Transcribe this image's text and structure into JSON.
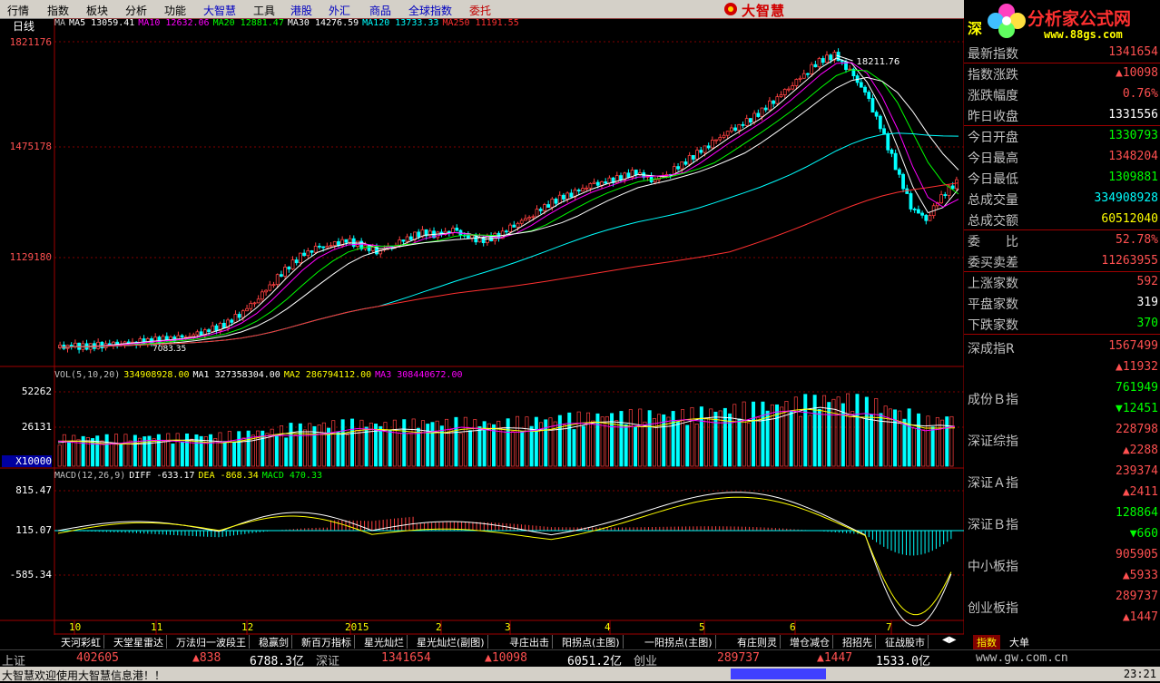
{
  "menu": [
    "行情",
    "指数",
    "板块",
    "分析",
    "功能",
    "大智慧",
    "工具",
    "港股",
    "外汇",
    "商品",
    "全球指数",
    "委托"
  ],
  "menu_colors": [
    "#000000",
    "#000000",
    "#000000",
    "#000000",
    "#000000",
    "#0000c0",
    "#000000",
    "#0000c0",
    "#0000c0",
    "#0000c0",
    "#0000c0",
    "#c00000"
  ],
  "brand": "大智慧",
  "right_logo": {
    "title": "分析家公式网",
    "url": "www.88gs.com",
    "corner_char": "深"
  },
  "chart_label": "日线",
  "ma_legend": [
    {
      "text": "MA",
      "color": "#c0c0c0"
    },
    {
      "text": "MA5 13059.41",
      "color": "#ffffff"
    },
    {
      "text": "MA10 12632.06",
      "color": "#ff00ff"
    },
    {
      "text": "MA20 12881.47",
      "color": "#00ff00"
    },
    {
      "text": "MA30 14276.59",
      "color": "#ffffff"
    },
    {
      "text": "MA120 13733.33",
      "color": "#00ffff"
    },
    {
      "text": "MA250 11191.55",
      "color": "#ff3030"
    }
  ],
  "vol_legend": [
    {
      "text": "VOL(5,10,20)",
      "color": "#c0c0c0"
    },
    {
      "text": "334908928.00",
      "color": "#ffff00"
    },
    {
      "text": "MA1 327358304.00",
      "color": "#ffffff"
    },
    {
      "text": "MA2 286794112.00",
      "color": "#ffff00"
    },
    {
      "text": "MA3 308440672.00",
      "color": "#ff00ff"
    }
  ],
  "macd_legend": [
    {
      "text": "MACD(12,26,9)",
      "color": "#c0c0c0"
    },
    {
      "text": "DIFF -633.17",
      "color": "#ffffff"
    },
    {
      "text": "DEA -868.34",
      "color": "#ffff00"
    },
    {
      "text": "MACD 470.33",
      "color": "#00ff00"
    }
  ],
  "price_axis": [
    "1821176",
    "1475178",
    "1129180"
  ],
  "vol_axis": [
    "52262",
    "26131",
    "X10000"
  ],
  "macd_axis": [
    "815.47",
    "115.07",
    "-585.34"
  ],
  "peak_label": "18211.76",
  "low_label": "7083.35",
  "time_axis": [
    "10",
    "11",
    "12",
    "2015",
    "2",
    "3",
    "4",
    "5",
    "6",
    "7"
  ],
  "chart_data": {
    "type": "candlestick",
    "title": "深成指 日线",
    "y_range": [
      6500,
      19000
    ],
    "annotations": [
      {
        "label": "18211.76",
        "type": "high"
      },
      {
        "label": "7083.35",
        "type": "low"
      }
    ],
    "close_series": [
      7150,
      7200,
      7180,
      7250,
      7300,
      7350,
      7400,
      7450,
      7500,
      7600,
      7800,
      8000,
      8400,
      8900,
      9500,
      10100,
      10600,
      10900,
      11000,
      11200,
      11000,
      10800,
      11000,
      11300,
      11500,
      11400,
      11600,
      11300,
      11200,
      11400,
      11800,
      12100,
      12500,
      12800,
      13000,
      13300,
      13400,
      13600,
      13800,
      13500,
      13700,
      14100,
      14500,
      14900,
      15300,
      15600,
      16000,
      16500,
      17000,
      17500,
      18000,
      18211,
      17600,
      16800,
      15500,
      14000,
      12500,
      12000,
      12900,
      13400
    ]
  },
  "panel": {
    "rows": [
      {
        "label": "最新指数",
        "value": "1341654",
        "color": "#ff5050"
      },
      {
        "label": "指数涨跌",
        "value": "▲10098",
        "color": "#ff5050"
      },
      {
        "label": "涨跌幅度",
        "value": "0.76%",
        "color": "#ff5050"
      },
      {
        "label": "昨日收盘",
        "value": "1331556",
        "color": "#ffffff"
      },
      {
        "label": "今日开盘",
        "value": "1330793",
        "color": "#00ff00"
      },
      {
        "label": "今日最高",
        "value": "1348204",
        "color": "#ff5050"
      },
      {
        "label": "今日最低",
        "value": "1309881",
        "color": "#00ff00"
      },
      {
        "label": "总成交量",
        "value": "334908928",
        "color": "#00ffff"
      },
      {
        "label": "总成交额",
        "value": "60512040",
        "color": "#ffff00"
      },
      {
        "label": "委　　比",
        "value": "52.78%",
        "color": "#ff5050"
      },
      {
        "label": "委买卖差",
        "value": "11263955",
        "color": "#ff5050"
      },
      {
        "label": "上涨家数",
        "value": "592",
        "color": "#ff5050"
      },
      {
        "label": "平盘家数",
        "value": "319",
        "color": "#ffffff"
      },
      {
        "label": "下跌家数",
        "value": "370",
        "color": "#00ff00"
      }
    ],
    "indices": [
      {
        "label": "深成指R",
        "value": "1567499",
        "change": "▲11932",
        "vcolor": "#ff5050",
        "ccolor": "#ff5050"
      },
      {
        "label": "成份Ｂ指",
        "value": "761949",
        "change": "▼12451",
        "vcolor": "#00ff00",
        "ccolor": "#00ff00"
      },
      {
        "label": "深证综指",
        "value": "228798",
        "change": "▲2288",
        "vcolor": "#ff5050",
        "ccolor": "#ff5050"
      },
      {
        "label": "深证Ａ指",
        "value": "239374",
        "change": "▲2411",
        "vcolor": "#ff5050",
        "ccolor": "#ff5050"
      },
      {
        "label": "深证Ｂ指",
        "value": "128864",
        "change": "▼660",
        "vcolor": "#00ff00",
        "ccolor": "#00ff00"
      },
      {
        "label": "中小板指",
        "value": "905905",
        "change": "▲5933",
        "vcolor": "#ff5050",
        "ccolor": "#ff5050"
      },
      {
        "label": "创业板指",
        "value": "289737",
        "change": "▲1447",
        "vcolor": "#ff5050",
        "ccolor": "#ff5050"
      }
    ]
  },
  "tabs": [
    "天河彩虹",
    "天堂星雷达",
    "万法归一波段王",
    "稳赢剑",
    "新百万指标",
    "星光灿烂",
    "星光灿烂(副图)",
    "寻庄出击",
    "阳拐点(主图)",
    "一阳拐点(主图)",
    "有庄则灵",
    "增仓减仓",
    "招招先",
    "征战股市"
  ],
  "right_tabs": [
    "指数",
    "大单"
  ],
  "ticker": [
    {
      "text": "上证",
      "color": "#c0c0c0"
    },
    {
      "text": "402605",
      "color": "#ff5050"
    },
    {
      "text": "▲838",
      "color": "#ff5050"
    },
    {
      "text": "6788.3亿",
      "color": "#ffffff"
    },
    {
      "text": "深证",
      "color": "#c0c0c0"
    },
    {
      "text": "1341654",
      "color": "#ff5050"
    },
    {
      "text": "▲10098",
      "color": "#ff5050"
    },
    {
      "text": "6051.2亿",
      "color": "#ffffff"
    },
    {
      "text": "创业",
      "color": "#c0c0c0"
    },
    {
      "text": "289737",
      "color": "#ff5050"
    },
    {
      "text": "▲1447",
      "color": "#ff5050"
    },
    {
      "text": "1533.0亿",
      "color": "#ffffff"
    },
    {
      "text": "www.gw.com.cn",
      "color": "#c0c0c0"
    }
  ],
  "status": {
    "message": "大智慧欢迎使用大智慧信息港！！",
    "time": "23:21"
  }
}
